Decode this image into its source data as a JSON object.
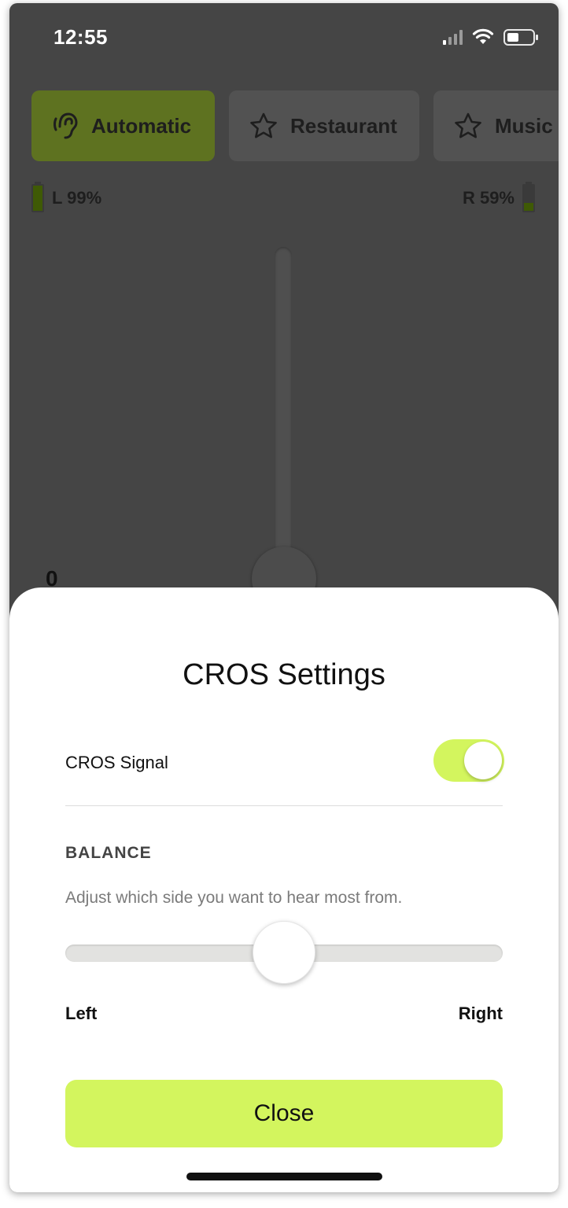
{
  "status_bar": {
    "time": "12:55",
    "signal_icon": "cellular-signal-icon",
    "wifi_icon": "wifi-icon",
    "battery_icon": "battery-icon"
  },
  "programs": {
    "tabs": [
      {
        "label": "Automatic",
        "icon": "ear-icon",
        "active": true
      },
      {
        "label": "Restaurant",
        "icon": "star-icon",
        "active": false
      },
      {
        "label": "Music",
        "icon": "star-icon",
        "active": false
      }
    ]
  },
  "battery": {
    "left_label": "L 99%",
    "left_level": 0.99,
    "right_label": "R 59%",
    "right_level": 0.59
  },
  "volume": {
    "value_label": "0"
  },
  "cros_sheet": {
    "title": "CROS Settings",
    "signal_label": "CROS Signal",
    "signal_on": true,
    "balance_header": "BALANCE",
    "balance_description": "Adjust which side you want to hear most from.",
    "balance_value": 0.5,
    "left_label": "Left",
    "right_label": "Right",
    "close_label": "Close"
  },
  "colors": {
    "accent": "#d3f55e",
    "dimmed_active_tab": "#5e7220",
    "overlay_background": "#454545"
  }
}
